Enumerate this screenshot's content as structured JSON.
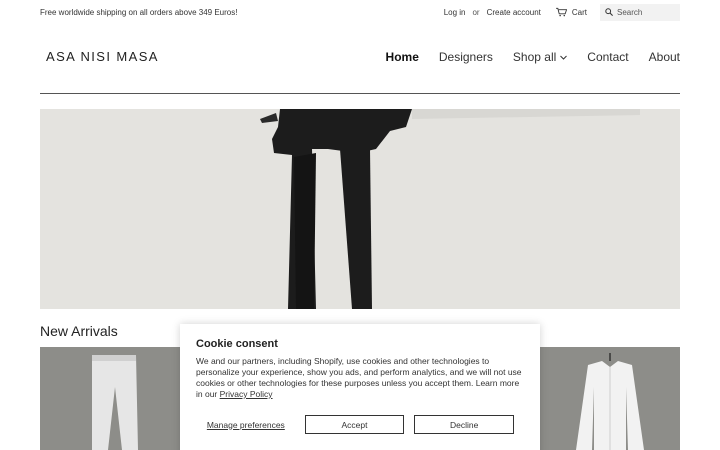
{
  "topbar": {
    "announcement": "Free worldwide shipping on all orders above 349 Euros!",
    "login": "Log in",
    "or": "or",
    "create_account": "Create account",
    "cart": "Cart",
    "search_placeholder": "Search"
  },
  "header": {
    "logo": "ASA NISI MASA",
    "nav": [
      {
        "label": "Home",
        "active": true
      },
      {
        "label": "Designers"
      },
      {
        "label": "Shop all",
        "dropdown": true
      },
      {
        "label": "Contact"
      },
      {
        "label": "About"
      }
    ]
  },
  "main": {
    "section_title": "New Arrivals"
  },
  "cookie": {
    "title": "Cookie consent",
    "body": "We and our partners, including Shopify, use cookies and other technologies to personalize your experience, show you ads, and perform analytics, and we will not use cookies or other technologies for these purposes unless you accept them. Learn more in our ",
    "privacy_link": "Privacy Policy",
    "manage": "Manage preferences",
    "accept": "Accept",
    "decline": "Decline"
  },
  "colors": {
    "text": "#222222",
    "hero_bg": "#e4e3df",
    "product_bg": "#8a8a86"
  }
}
